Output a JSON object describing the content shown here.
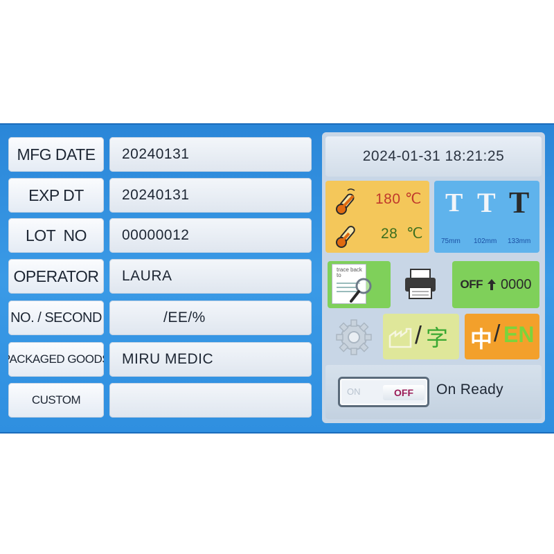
{
  "form": {
    "rows": [
      {
        "label": "MFG DATE",
        "value": "20240131"
      },
      {
        "label": "EXP DT",
        "value": "20240131"
      },
      {
        "label": "LOT  NO",
        "value": "00000012"
      },
      {
        "label": "OPERATOR",
        "value": "LAURA"
      },
      {
        "label": "NO. / SECOND",
        "value": "/EE/%"
      },
      {
        "label": "PACKAGED GOODS",
        "value": "MIRU MEDIC"
      },
      {
        "label": "CUSTOM",
        "value": ""
      }
    ]
  },
  "panel": {
    "datetime": "2024-01-31 18:21:25",
    "temperature": {
      "upper": "180 ℃",
      "lower": "28  ℃"
    },
    "font_sizes": {
      "letter": "T",
      "sizes": [
        "75mm",
        "102mm",
        "133mm"
      ]
    },
    "trace_icon_text": "trace back to",
    "counter": {
      "state": "OFF",
      "value": "0000"
    },
    "logo_tile": {
      "slash": "/",
      "char": "字"
    },
    "language": {
      "zh": "中",
      "slash": "/",
      "en": "EN"
    },
    "toggle": {
      "on_label": "ON",
      "off_label": "OFF"
    },
    "status": "On Ready"
  },
  "colors": {
    "screen_blue": "#2f8fe0",
    "temp_tile": "#f4c75a",
    "font_tile": "#5fb3ec",
    "green_tile": "#7fd05a",
    "language_tile": "#f3a02b",
    "temp_upper_color": "#c0392b",
    "temp_lower_color": "#3c6e1e"
  }
}
